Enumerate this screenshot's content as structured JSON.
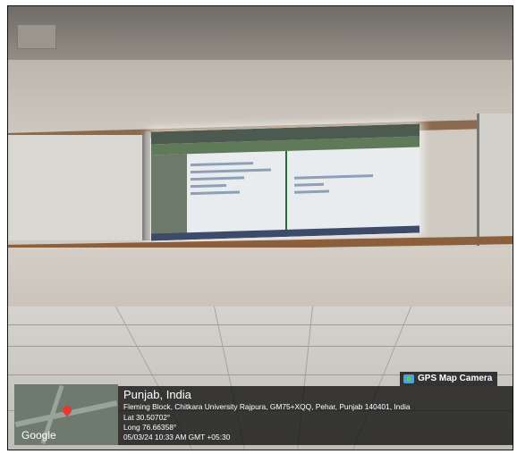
{
  "stamp": {
    "app_label": "GPS Map Camera",
    "app_icon": "gps-camera-icon",
    "place_title": "Punjab, India",
    "address": "Fleming Block, Chitkara University Rajpura, GM75+XQQ, Pehar, Punjab 140401, India",
    "latitude": "Lat 30.50702°",
    "longitude": "Long 76.66358°",
    "datetime": "05/03/24 10:33 AM GMT +05:30",
    "map_brand": "Google",
    "pin_color": "#e53935"
  },
  "scene": {
    "projection_screen_color": "#e8ecef",
    "rail_color": "#8b5e3c"
  }
}
